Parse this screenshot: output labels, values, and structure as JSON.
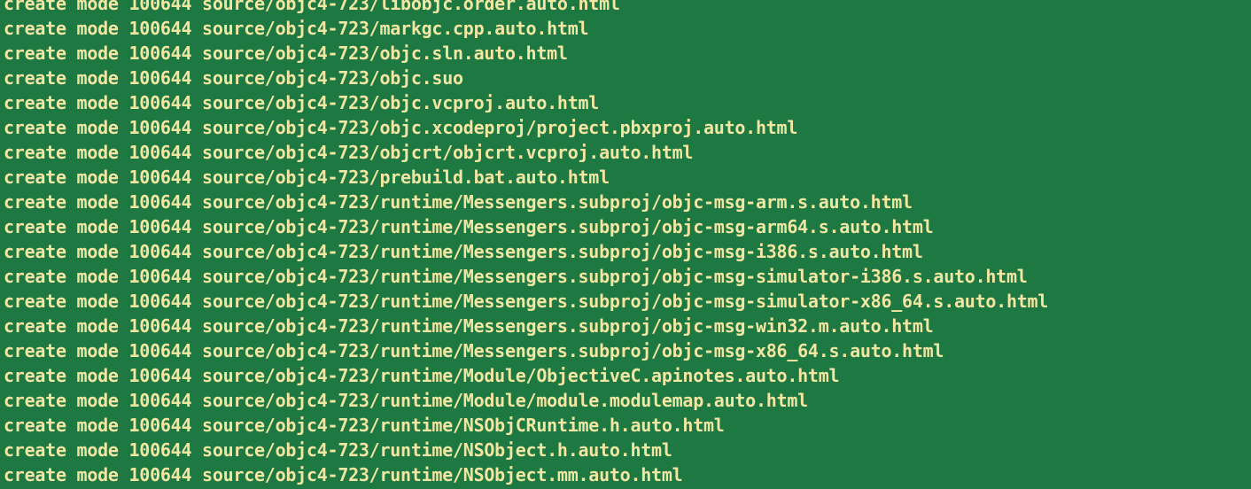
{
  "terminal": {
    "lines": [
      "create mode 100644 source/objc4-723/libobjc.order.auto.html",
      "create mode 100644 source/objc4-723/markgc.cpp.auto.html",
      "create mode 100644 source/objc4-723/objc.sln.auto.html",
      "create mode 100644 source/objc4-723/objc.suo",
      "create mode 100644 source/objc4-723/objc.vcproj.auto.html",
      "create mode 100644 source/objc4-723/objc.xcodeproj/project.pbxproj.auto.html",
      "create mode 100644 source/objc4-723/objcrt/objcrt.vcproj.auto.html",
      "create mode 100644 source/objc4-723/prebuild.bat.auto.html",
      "create mode 100644 source/objc4-723/runtime/Messengers.subproj/objc-msg-arm.s.auto.html",
      "create mode 100644 source/objc4-723/runtime/Messengers.subproj/objc-msg-arm64.s.auto.html",
      "create mode 100644 source/objc4-723/runtime/Messengers.subproj/objc-msg-i386.s.auto.html",
      "create mode 100644 source/objc4-723/runtime/Messengers.subproj/objc-msg-simulator-i386.s.auto.html",
      "create mode 100644 source/objc4-723/runtime/Messengers.subproj/objc-msg-simulator-x86_64.s.auto.html",
      "create mode 100644 source/objc4-723/runtime/Messengers.subproj/objc-msg-win32.m.auto.html",
      "create mode 100644 source/objc4-723/runtime/Messengers.subproj/objc-msg-x86_64.s.auto.html",
      "create mode 100644 source/objc4-723/runtime/Module/ObjectiveC.apinotes.auto.html",
      "create mode 100644 source/objc4-723/runtime/Module/module.modulemap.auto.html",
      "create mode 100644 source/objc4-723/runtime/NSObjCRuntime.h.auto.html",
      "create mode 100644 source/objc4-723/runtime/NSObject.h.auto.html",
      "create mode 100644 source/objc4-723/runtime/NSObject.mm.auto.html"
    ]
  }
}
